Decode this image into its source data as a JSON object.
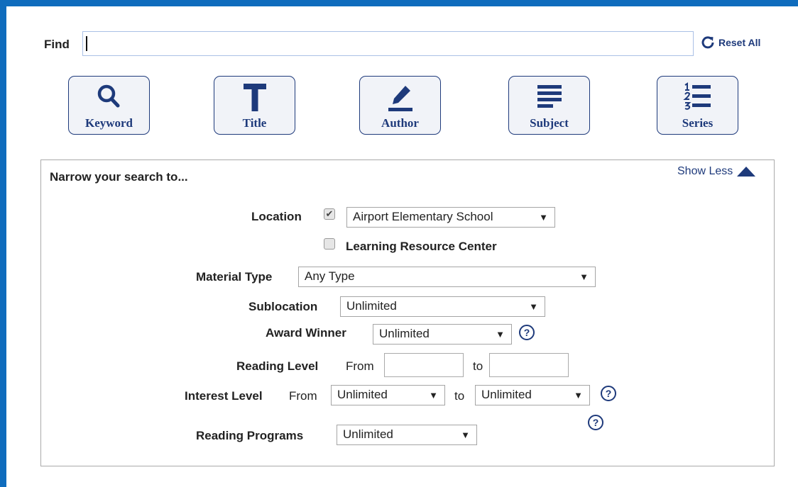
{
  "search": {
    "find_label": "Find",
    "query_value": "",
    "reset_label": "Reset All",
    "buttons": [
      {
        "label": "Keyword",
        "icon": "magnifier-icon"
      },
      {
        "label": "Title",
        "icon": "letter-t-icon"
      },
      {
        "label": "Author",
        "icon": "pencil-icon"
      },
      {
        "label": "Subject",
        "icon": "lines-icon"
      },
      {
        "label": "Series",
        "icon": "numbered-list-icon"
      }
    ]
  },
  "narrow": {
    "title": "Narrow your search to...",
    "show_less": "Show Less",
    "location": {
      "label": "Location",
      "checked": true,
      "selected": "Airport Elementary School",
      "lrc_checked": false,
      "lrc_label": "Learning Resource Center"
    },
    "material_type": {
      "label": "Material Type",
      "selected": "Any Type"
    },
    "sublocation": {
      "label": "Sublocation",
      "selected": "Unlimited"
    },
    "award_winner": {
      "label": "Award Winner",
      "selected": "Unlimited"
    },
    "reading_level": {
      "label": "Reading Level",
      "from": "From",
      "to": "to",
      "from_value": "",
      "to_value": ""
    },
    "interest_level": {
      "label": "Interest Level",
      "from": "From",
      "to": "to",
      "from_selected": "Unlimited",
      "to_selected": "Unlimited"
    },
    "reading_programs": {
      "label": "Reading Programs",
      "selected": "Unlimited"
    },
    "help_glyph": "?",
    "dropdown_arrow": "▼",
    "check_glyph": "✔"
  },
  "colors": {
    "frame": "#0f6cbd",
    "accent": "#1e3a7b",
    "button_bg": "#f1f3f8"
  }
}
